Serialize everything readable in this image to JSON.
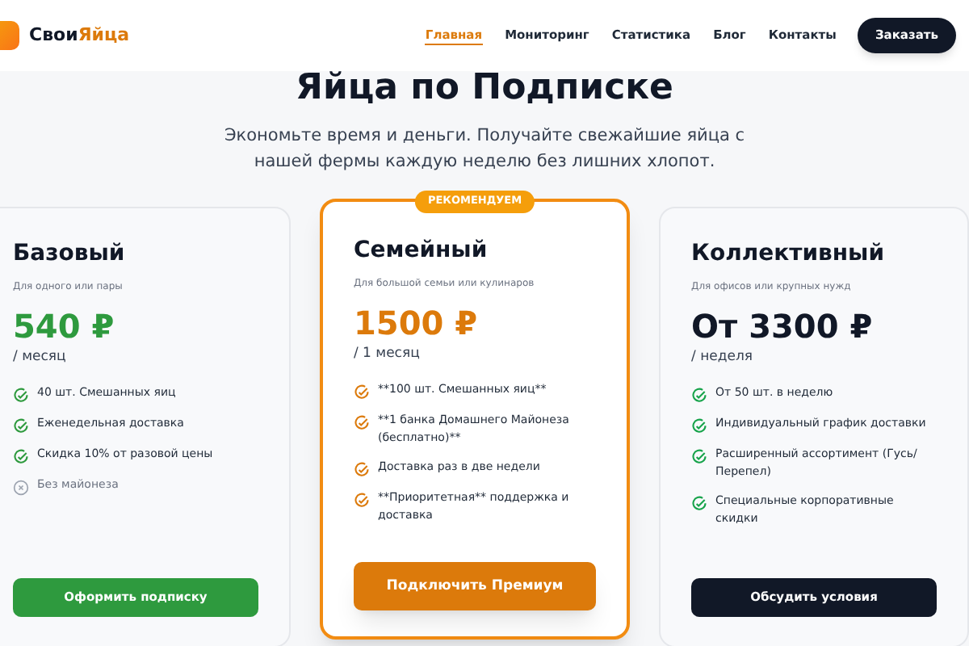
{
  "brand": {
    "part_1": "Свои",
    "part_2": "Яйца"
  },
  "nav": [
    {
      "label": "Главная",
      "selected": true
    },
    {
      "label": "Мониторинг",
      "selected": false
    },
    {
      "label": "Статистика",
      "selected": false
    },
    {
      "label": "Блог",
      "selected": false
    },
    {
      "label": "Контакты",
      "selected": false
    }
  ],
  "order_button": "Заказать",
  "title": "Яйца по Подписке",
  "subtitle": "Экономьте время и деньги. Получайте свежайшие яйца с нашей фермы каждую неделю без лишних хлопот.",
  "plans": [
    {
      "name": "Базовый",
      "note": "Для одного или пары",
      "price": "540 ₽",
      "period": "/ месяц",
      "color": "#2e9a3e",
      "featured": false,
      "button": "Оформить подписку",
      "features": [
        {
          "text": "40 шт. Смешанных яиц",
          "included": true
        },
        {
          "text": "Еженедельная доставка",
          "included": true
        },
        {
          "text": "Скидка 10% от разовой цены",
          "included": true
        },
        {
          "text": "Без майонеза",
          "included": false
        }
      ]
    },
    {
      "name": "Семейный",
      "note": "Для большой семьи или кулинаров",
      "price": "1500 ₽",
      "period": "/ 1 месяц",
      "color": "#dc7a0b",
      "featured": true,
      "badge": "РЕКОМЕНДУЕМ",
      "button": "Подключить Премиум",
      "features": [
        {
          "text": "**100 шт. Смешанных яиц**",
          "included": true
        },
        {
          "text": "**1 банка Домашнего Майонеза (бесплатно)**",
          "included": true
        },
        {
          "text": "Доставка раз в две недели",
          "included": true
        },
        {
          "text": "**Приоритетная** поддержка и доставка",
          "included": true
        }
      ]
    },
    {
      "name": "Коллективный",
      "note": "Для офисов или крупных нужд",
      "price": "От 3300 ₽",
      "period": "/ неделя",
      "color": "#111827",
      "featured": false,
      "button": "Обсудить условия",
      "features": [
        {
          "text": "От 50 шт. в неделю",
          "included": true
        },
        {
          "text": "Индивидуальный график доставки",
          "included": true
        },
        {
          "text": "Расширенный ассортимент (Гусь/Перепел)",
          "included": true
        },
        {
          "text": "Специальные корпоративные скидки",
          "included": true
        }
      ]
    }
  ]
}
